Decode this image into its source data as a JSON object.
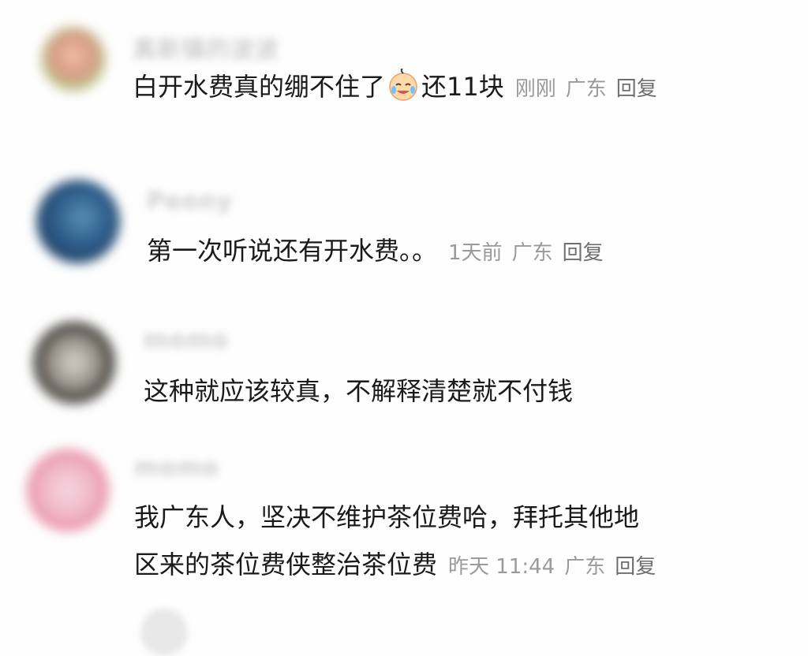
{
  "comments": [
    {
      "username": "真新镇的波波",
      "text_before_emoji": "白开水费真的绷不住了",
      "emoji": "crying-laughing-face-icon",
      "text_after_emoji": "还11块",
      "time": "刚刚",
      "location": "广东",
      "reply_label": "回复"
    },
    {
      "username": "Peony",
      "text": "第一次听说还有开水费。。",
      "time": "1天前",
      "location": "广东",
      "reply_label": "回复"
    },
    {
      "username": "momo",
      "text": "这种就应该较真，不解释清楚就不付钱"
    },
    {
      "username": "momo",
      "text_line1": "我广东人，坚决不维护茶位费哈，拜托其他地",
      "text_line2": "区来的茶位费侠整治茶位费",
      "time": "昨天 11:44",
      "location": "广东",
      "reply_label": "回复"
    }
  ],
  "colors": {
    "meta_gray": "#9a9a9a",
    "username_gray": "#cfcfcf",
    "text": "#1a1a1a"
  }
}
